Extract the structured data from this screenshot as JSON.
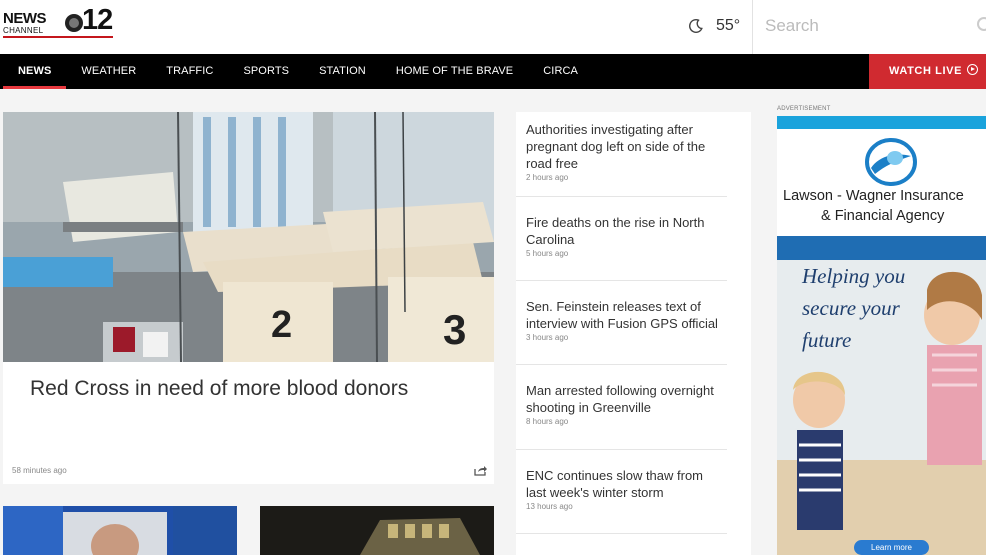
{
  "header": {
    "logo": {
      "word1": "NEWS",
      "word2": "CHANNEL",
      "number": "12"
    },
    "weather": {
      "icon": "moon-icon",
      "temperature": "55°"
    },
    "search": {
      "placeholder": "Search"
    }
  },
  "nav": {
    "items": [
      {
        "label": "NEWS",
        "active": true
      },
      {
        "label": "WEATHER"
      },
      {
        "label": "TRAFFIC"
      },
      {
        "label": "SPORTS"
      },
      {
        "label": "STATION"
      },
      {
        "label": "HOME OF THE BRAVE"
      },
      {
        "label": "CIRCA"
      }
    ],
    "watch_live": "WATCH LIVE"
  },
  "hero": {
    "title": "Red Cross in need of more blood donors",
    "time": "58 minutes ago"
  },
  "headlines": [
    {
      "title": "Authorities investigating after pregnant dog left on side of the road free",
      "time": "2 hours ago"
    },
    {
      "title": "Fire deaths on the rise in North Carolina",
      "time": "5 hours ago"
    },
    {
      "title": "Sen. Feinstein releases text of interview with Fusion GPS official",
      "time": "3 hours ago"
    },
    {
      "title": "Man arrested following overnight shooting in Greenville",
      "time": "8 hours ago"
    },
    {
      "title": "ENC continues slow thaw from last week's winter storm",
      "time": "13 hours ago"
    }
  ],
  "ad": {
    "label": "ADVERTISEMENT",
    "brand_line1": "Lawson - Wagner Insurance",
    "brand_line2": "& Financial Agency",
    "tagline_lines": [
      "Helping you",
      "secure your",
      "future"
    ],
    "cta": "Learn more"
  },
  "colors": {
    "nav_bg": "#000000",
    "active_underline": "#e8393f",
    "watch_live_bg": "#d02a30",
    "ad_accent": "#1aa3dc"
  }
}
